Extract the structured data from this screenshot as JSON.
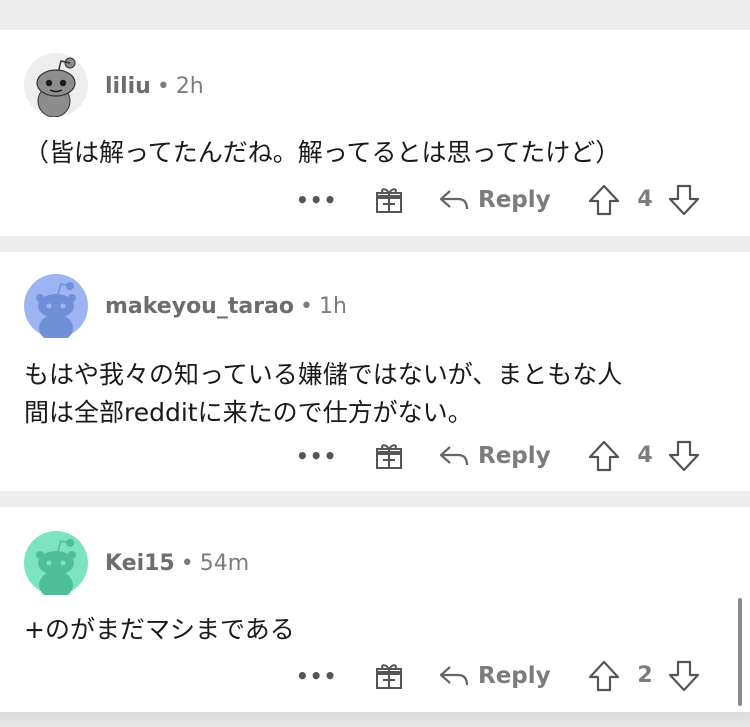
{
  "comments": [
    {
      "username": "liliu",
      "separator": "•",
      "time": "2h",
      "text": "（皆は解ってたんだね。解ってるとは思ってたけど）",
      "more_label": "•••",
      "reply_label": "Reply",
      "score": "4",
      "avatar_color": "#eeeeee",
      "avatar_body_color": "#8d8d8d"
    },
    {
      "username": "makeyou_tarao",
      "separator": "•",
      "time": "1h",
      "text_line1": "もはや我々の知っている嫌儲ではないが、まともな人",
      "text_line2": "間は全部redditに来たので仕方がない。",
      "more_label": "•••",
      "reply_label": "Reply",
      "score": "4",
      "avatar_color": "#9db4f2",
      "avatar_body_color": "#6f8fd8"
    },
    {
      "username": "Kei15",
      "separator": "•",
      "time": "54m",
      "text": "+のがまだマシまである",
      "more_label": "•••",
      "reply_label": "Reply",
      "score": "2",
      "avatar_color": "#7ce3c1",
      "avatar_body_color": "#4fbf99"
    }
  ]
}
